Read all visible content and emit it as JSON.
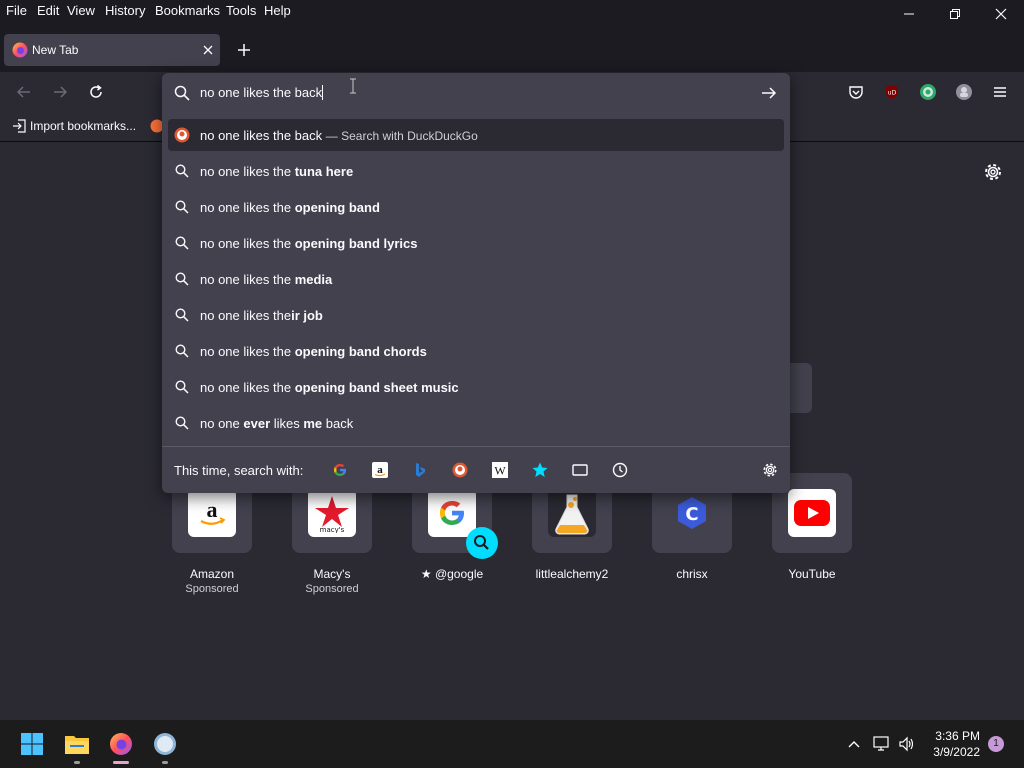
{
  "menubar": {
    "items": [
      "File",
      "Edit",
      "View",
      "History",
      "Bookmarks",
      "Tools",
      "Help"
    ]
  },
  "tab": {
    "title": "New Tab"
  },
  "bookmarks": {
    "import_label": "Import bookmarks..."
  },
  "urlbar": {
    "value": "no one likes the back",
    "suggestions": [
      {
        "icon": "duckduckgo-icon",
        "prefix": "no one likes the back",
        "bold": "",
        "suffix": "",
        "action": "— Search with DuckDuckGo",
        "selected": true
      },
      {
        "icon": "search-icon",
        "prefix": "no one likes the ",
        "bold": "tuna here",
        "suffix": ""
      },
      {
        "icon": "search-icon",
        "prefix": "no one likes the ",
        "bold": "opening band",
        "suffix": ""
      },
      {
        "icon": "search-icon",
        "prefix": "no one likes the ",
        "bold": "opening band lyrics",
        "suffix": ""
      },
      {
        "icon": "search-icon",
        "prefix": "no one likes the ",
        "bold": "media",
        "suffix": ""
      },
      {
        "icon": "search-icon",
        "prefix": "no one likes the",
        "bold": "ir job",
        "suffix": ""
      },
      {
        "icon": "search-icon",
        "prefix": "no one likes the ",
        "bold": "opening band chords",
        "suffix": ""
      },
      {
        "icon": "search-icon",
        "prefix": "no one likes the ",
        "bold": "opening band sheet music",
        "suffix": ""
      },
      {
        "icon": "search-icon",
        "prefix": "no one ",
        "bold": "ever",
        "suffix": " likes ",
        "bold2": "me",
        "suffix2": " back"
      }
    ],
    "oneoff_label": "This time, search with:",
    "engines": [
      "google-icon",
      "amazon-icon",
      "bing-icon",
      "duckduckgo-icon",
      "wikipedia-icon",
      "bookmarks-star-icon",
      "tabs-icon",
      "history-icon"
    ]
  },
  "top_sites": [
    {
      "name": "Amazon",
      "sub": "Sponsored"
    },
    {
      "name": "Macy's",
      "sub": "Sponsored"
    },
    {
      "name": "@google",
      "sub": ""
    },
    {
      "name": "littlealchemy2",
      "sub": ""
    },
    {
      "name": "chrisx",
      "sub": ""
    },
    {
      "name": "YouTube",
      "sub": ""
    }
  ],
  "taskbar": {
    "time": "3:36 PM",
    "date": "3/9/2022",
    "notifications": "1"
  },
  "colors": {
    "chrome_dark": "#1c1b22",
    "chrome": "#2b2a33",
    "panel": "#42414d",
    "accent_cyan": "#00ddff",
    "youtube_red": "#ff0000",
    "macys_red": "#e21a2c",
    "chrisx_blue": "#3b5bdb",
    "amazon_orange": "#ff9900"
  }
}
